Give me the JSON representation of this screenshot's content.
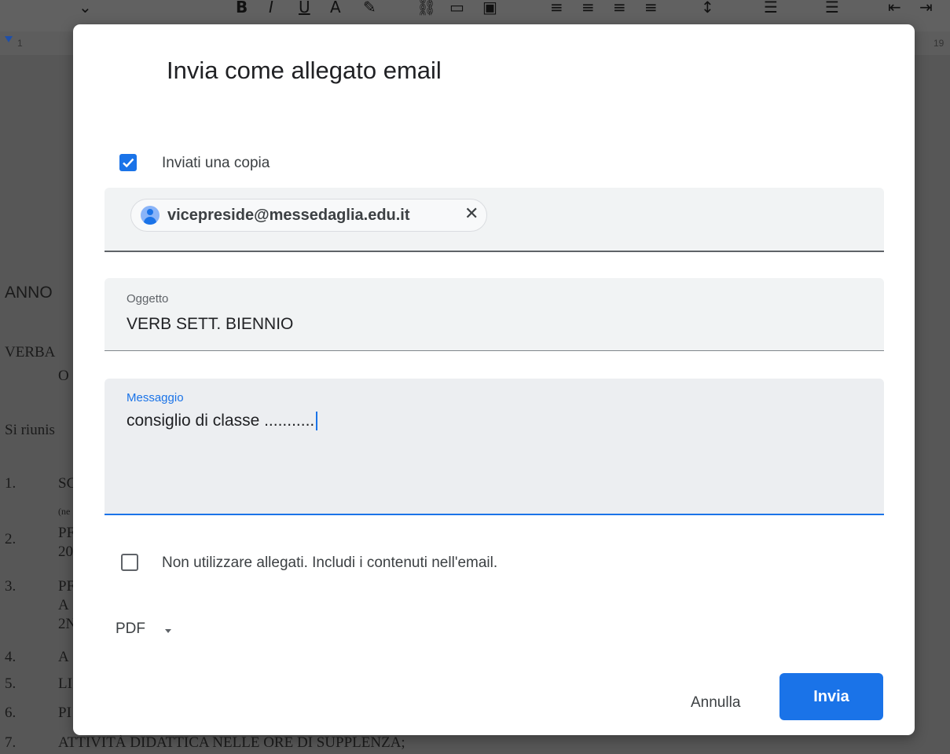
{
  "dialog": {
    "title": "Invia come allegato email",
    "send_copy": {
      "label": "Inviati una copia",
      "checked": true
    },
    "recipients": [
      {
        "email": "vicepreside@messedaglia.edu.it"
      }
    ],
    "subject": {
      "label": "Oggetto",
      "value": "VERB SETT. BIENNIO"
    },
    "message": {
      "label": "Messaggio",
      "value": "consiglio di classe ..........."
    },
    "no_attachment": {
      "label": "Non utilizzare allegati. Includi i contenuti nell'email.",
      "checked": false
    },
    "format_select": {
      "selected": "PDF"
    },
    "buttons": {
      "cancel": "Annulla",
      "send": "Invia"
    }
  },
  "background_document": {
    "ruler_left": "1",
    "ruler_right": "19",
    "lines": [
      "ANNO",
      "VERBA",
      "O",
      "Si riunis",
      "1.",
      "SC",
      "(ne",
      "2.",
      "PF",
      "20",
      "3.",
      "PF",
      "A",
      "2N",
      "4.",
      "A",
      "5.",
      "LI",
      "6.",
      "PI",
      "7.",
      "ATTIVITÀ DIDATTICA NELLE ORE DI SUPPLENZA;"
    ]
  },
  "colors": {
    "accent": "#1a73e8",
    "overlay": "#575757",
    "dialog_bg": "#ffffff",
    "field_bg": "#f1f3f4"
  }
}
